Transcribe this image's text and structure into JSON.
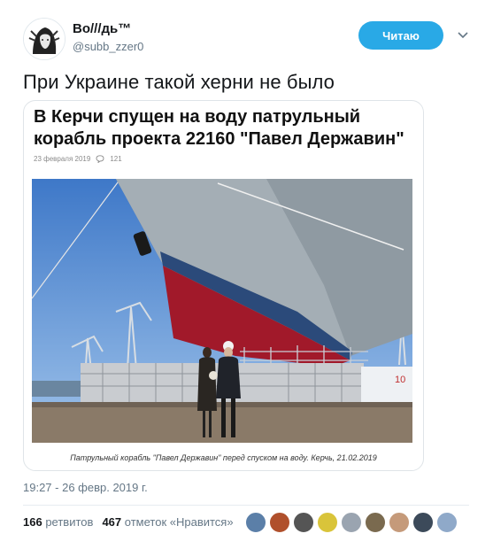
{
  "header": {
    "display_name": "Во///дь™",
    "handle": "@subb_zzer0",
    "follow_label": "Читаю"
  },
  "tweet": {
    "text": "При Украине такой херни не было"
  },
  "card": {
    "title": "В Керчи спущен на воду патрульный корабль проекта 22160 \"Павел Державин\"",
    "date": "23 февраля 2019",
    "comments": "121",
    "hull_number": "10",
    "caption": "Патрульный корабль \"Павел Державин\" перед спуском на воду. Керчь, 21.02.2019"
  },
  "footer": {
    "timestamp": "19:27 - 26 февр. 2019 г.",
    "retweets_count": "166",
    "retweets_label": "ретвитов",
    "likes_count": "467",
    "likes_label": "отметок «Нравится»",
    "liker_colors": [
      "#5b7fa8",
      "#b0502c",
      "#555555",
      "#d9c43a",
      "#9aa4b0",
      "#7a6a4f",
      "#c59a7a",
      "#3c4a5a",
      "#8fa9c9"
    ]
  },
  "colors": {
    "follow_button": "#29a9e6",
    "secondary_text": "#657786"
  }
}
